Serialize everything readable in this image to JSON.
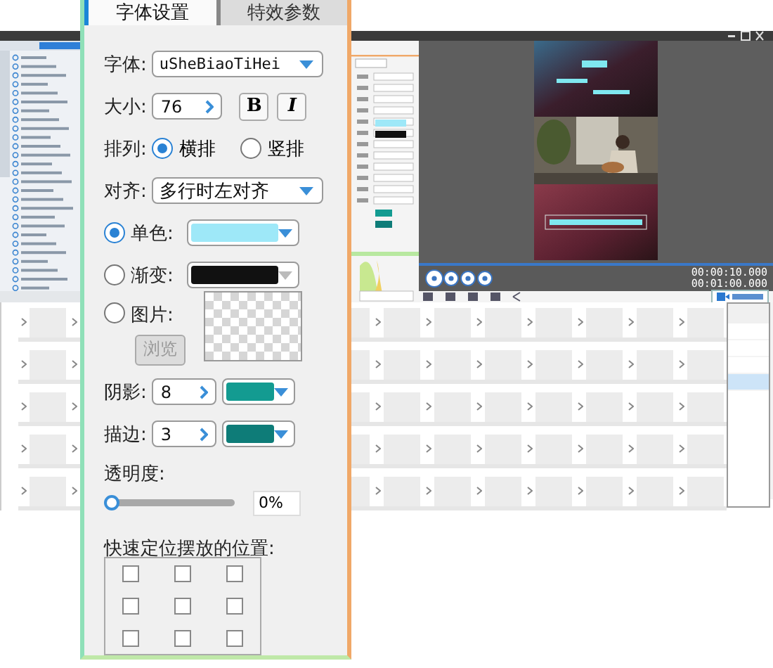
{
  "panel": {
    "tabs": [
      {
        "label": "字体设置",
        "selected": true
      },
      {
        "label": "特效参数",
        "selected": false
      }
    ],
    "font": {
      "label": "字体:",
      "value": "uSheBiaoTiHei"
    },
    "size": {
      "label": "大小:",
      "value": "76",
      "bold_label": "B",
      "italic_label": "I"
    },
    "arrangement": {
      "label": "排列:",
      "options": [
        {
          "label": "横排",
          "selected": true
        },
        {
          "label": "竖排",
          "selected": false
        }
      ]
    },
    "align": {
      "label": "对齐:",
      "value": "多行时左对齐"
    },
    "fill_modes": [
      {
        "kind": "solid",
        "label": "单色:",
        "selected": true,
        "color": "#9ee8f8"
      },
      {
        "kind": "gradient",
        "label": "渐变:",
        "selected": false,
        "color": "#111111"
      },
      {
        "label": "图片:",
        "selected": false
      }
    ],
    "browse_button": {
      "label": "浏览",
      "disabled": true
    },
    "shadow": {
      "label": "阴影:",
      "value": "8",
      "color": "#139b91"
    },
    "outline": {
      "label": "描边:",
      "value": "3",
      "color": "#0e7c78"
    },
    "opacity": {
      "label": "透明度:",
      "level": 0,
      "reading": "0%"
    },
    "position": {
      "label": "快速定位摆放的位置:",
      "cells": [
        {
          "checked": false
        },
        {
          "checked": false
        },
        {
          "checked": false
        },
        {
          "checked": false
        },
        {
          "checked": false
        },
        {
          "checked": false
        },
        {
          "checked": false
        },
        {
          "checked": false
        },
        {
          "checked": false
        }
      ]
    }
  },
  "app": {
    "timecodes": [
      "00:00:10.000",
      "00:01:00.000"
    ],
    "caption_rows": [
      {
        "selected": false
      },
      {
        "selected": false
      },
      {
        "selected": false
      },
      {
        "selected": true
      }
    ]
  }
}
